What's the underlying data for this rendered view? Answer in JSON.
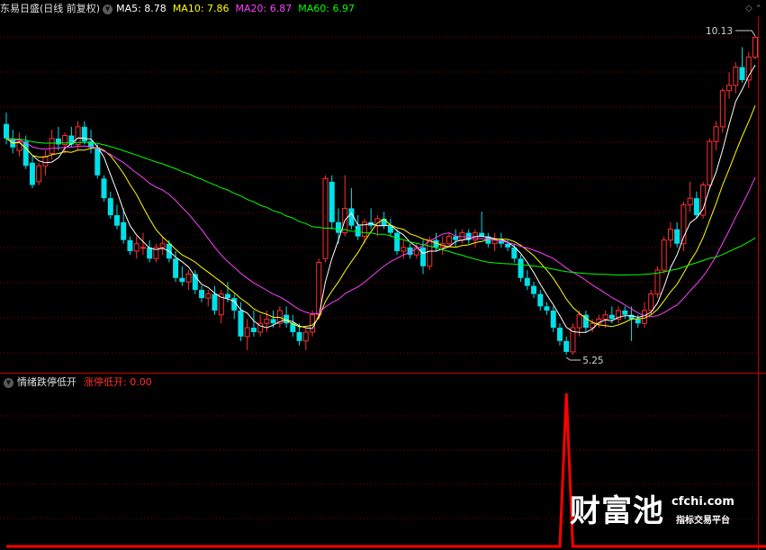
{
  "header": {
    "stock_title": "东易日盛(日线 前复权)",
    "ma_items": [
      {
        "label": "MA5: 8.78",
        "color": "#ffffff"
      },
      {
        "label": "MA10: 7.86",
        "color": "#ffff00"
      },
      {
        "label": "MA20: 6.87",
        "color": "#ff40ff"
      },
      {
        "label": "MA60: 6.97",
        "color": "#00ff00"
      }
    ]
  },
  "indicator_header": {
    "name": "情绪跌停低开",
    "value_label": "涨停低开: 0.00",
    "value_color": "#ff3030"
  },
  "watermark": {
    "brand": "财富池",
    "site": "cfchi.com",
    "tagline": "指标交易平台"
  },
  "colors": {
    "up": "#ff3030",
    "down": "#00e0e8",
    "grid": "#8a0000",
    "background": "#000000"
  },
  "chart_data": [
    {
      "type": "candlestick",
      "title": "东易日盛(日线 前复权)",
      "y_scale": "log",
      "price_annotations": {
        "high": "10.13",
        "low": "5.25"
      },
      "candles": [
        [
          8.45,
          8.65,
          8.1,
          8.2
        ],
        [
          8.2,
          8.35,
          7.95,
          8.05
        ],
        [
          8.0,
          8.3,
          7.9,
          8.15
        ],
        [
          8.15,
          8.25,
          7.7,
          7.75
        ],
        [
          7.8,
          7.9,
          7.4,
          7.45
        ],
        [
          7.5,
          7.8,
          7.45,
          7.75
        ],
        [
          7.75,
          8.0,
          7.6,
          7.9
        ],
        [
          7.95,
          8.35,
          7.85,
          8.2
        ],
        [
          8.2,
          8.4,
          8.0,
          8.1
        ],
        [
          8.1,
          8.3,
          7.95,
          8.25
        ],
        [
          8.25,
          8.4,
          8.05,
          8.1
        ],
        [
          8.1,
          8.5,
          8.0,
          8.4
        ],
        [
          8.4,
          8.5,
          8.1,
          8.15
        ],
        [
          8.15,
          8.35,
          7.95,
          8.05
        ],
        [
          8.05,
          8.1,
          7.55,
          7.6
        ],
        [
          7.55,
          7.6,
          7.2,
          7.25
        ],
        [
          7.25,
          7.35,
          6.95,
          7.0
        ],
        [
          7.0,
          7.15,
          6.8,
          6.85
        ],
        [
          6.9,
          7.1,
          6.6,
          6.65
        ],
        [
          6.65,
          6.7,
          6.45,
          6.5
        ],
        [
          6.5,
          6.7,
          6.4,
          6.6
        ],
        [
          6.55,
          6.75,
          6.45,
          6.55
        ],
        [
          6.55,
          6.65,
          6.35,
          6.4
        ],
        [
          6.4,
          6.6,
          6.35,
          6.55
        ],
        [
          6.55,
          6.7,
          6.45,
          6.6
        ],
        [
          6.6,
          6.65,
          6.35,
          6.4
        ],
        [
          6.4,
          6.5,
          6.1,
          6.15
        ],
        [
          6.15,
          6.3,
          6.05,
          6.1
        ],
        [
          6.1,
          6.25,
          6.0,
          6.2
        ],
        [
          6.2,
          6.25,
          5.95,
          6.0
        ],
        [
          6.0,
          6.05,
          5.85,
          5.9
        ],
        [
          5.9,
          6.0,
          5.8,
          5.95
        ],
        [
          5.95,
          6.05,
          5.7,
          5.75
        ],
        [
          5.7,
          6.0,
          5.6,
          5.95
        ],
        [
          5.95,
          6.1,
          5.85,
          5.9
        ],
        [
          5.9,
          5.95,
          5.65,
          5.75
        ],
        [
          5.75,
          5.85,
          5.4,
          5.45
        ],
        [
          5.45,
          5.65,
          5.3,
          5.55
        ],
        [
          5.55,
          5.75,
          5.45,
          5.5
        ],
        [
          5.5,
          5.7,
          5.45,
          5.6
        ],
        [
          5.6,
          5.75,
          5.5,
          5.65
        ],
        [
          5.65,
          5.75,
          5.55,
          5.6
        ],
        [
          5.6,
          5.8,
          5.55,
          5.75
        ],
        [
          5.7,
          5.8,
          5.55,
          5.6
        ],
        [
          5.6,
          5.7,
          5.45,
          5.5
        ],
        [
          5.5,
          5.6,
          5.35,
          5.4
        ],
        [
          5.4,
          5.55,
          5.3,
          5.5
        ],
        [
          5.5,
          5.75,
          5.45,
          5.7
        ],
        [
          5.7,
          6.4,
          5.65,
          6.35
        ],
        [
          6.4,
          7.6,
          6.35,
          7.55
        ],
        [
          7.5,
          7.6,
          6.8,
          6.9
        ],
        [
          6.9,
          7.1,
          6.6,
          6.75
        ],
        [
          6.75,
          7.6,
          6.7,
          7.1
        ],
        [
          7.1,
          7.4,
          6.8,
          6.85
        ],
        [
          6.85,
          7.0,
          6.65,
          6.7
        ],
        [
          6.7,
          6.95,
          6.6,
          6.9
        ],
        [
          6.9,
          7.1,
          6.8,
          6.85
        ],
        [
          6.85,
          7.0,
          6.7,
          6.95
        ],
        [
          6.95,
          7.05,
          6.8,
          6.85
        ],
        [
          6.85,
          6.95,
          6.7,
          6.75
        ],
        [
          6.75,
          6.8,
          6.45,
          6.5
        ],
        [
          6.5,
          6.65,
          6.4,
          6.55
        ],
        [
          6.55,
          6.6,
          6.4,
          6.45
        ],
        [
          6.45,
          6.6,
          6.4,
          6.55
        ],
        [
          6.55,
          6.65,
          6.2,
          6.3
        ],
        [
          6.3,
          6.7,
          6.25,
          6.65
        ],
        [
          6.65,
          6.75,
          6.5,
          6.55
        ],
        [
          6.55,
          6.7,
          6.45,
          6.6
        ],
        [
          6.6,
          6.75,
          6.55,
          6.7
        ],
        [
          6.7,
          6.8,
          6.55,
          6.65
        ],
        [
          6.65,
          6.8,
          6.6,
          6.75
        ],
        [
          6.75,
          6.8,
          6.6,
          6.65
        ],
        [
          6.65,
          6.8,
          6.55,
          6.75
        ],
        [
          6.75,
          7.05,
          6.7,
          6.7
        ],
        [
          6.7,
          6.75,
          6.55,
          6.6
        ],
        [
          6.6,
          6.75,
          6.5,
          6.65
        ],
        [
          6.65,
          6.75,
          6.55,
          6.6
        ],
        [
          6.6,
          6.65,
          6.5,
          6.55
        ],
        [
          6.55,
          6.6,
          6.35,
          6.4
        ],
        [
          6.4,
          6.45,
          6.1,
          6.15
        ],
        [
          6.15,
          6.25,
          6.0,
          6.05
        ],
        [
          6.05,
          6.1,
          5.9,
          5.95
        ],
        [
          5.95,
          6.0,
          5.75,
          5.8
        ],
        [
          5.8,
          5.85,
          5.7,
          5.75
        ],
        [
          5.75,
          5.8,
          5.5,
          5.55
        ],
        [
          5.55,
          5.6,
          5.35,
          5.4
        ],
        [
          5.4,
          5.45,
          5.25,
          5.28
        ],
        [
          5.28,
          5.6,
          5.25,
          5.55
        ],
        [
          5.55,
          5.75,
          5.45,
          5.7
        ],
        [
          5.7,
          5.75,
          5.5,
          5.55
        ],
        [
          5.55,
          5.65,
          5.5,
          5.6
        ],
        [
          5.6,
          5.7,
          5.55,
          5.65
        ],
        [
          5.65,
          5.75,
          5.55,
          5.7
        ],
        [
          5.7,
          5.8,
          5.6,
          5.65
        ],
        [
          5.65,
          5.8,
          5.6,
          5.75
        ],
        [
          5.75,
          5.8,
          5.65,
          5.7
        ],
        [
          5.7,
          5.8,
          5.4,
          5.65
        ],
        [
          5.65,
          5.7,
          5.55,
          5.6
        ],
        [
          5.6,
          5.85,
          5.55,
          5.75
        ],
        [
          5.75,
          6.0,
          5.7,
          5.95
        ],
        [
          5.95,
          6.3,
          5.9,
          6.25
        ],
        [
          6.25,
          6.7,
          6.2,
          6.65
        ],
        [
          6.65,
          6.9,
          6.55,
          6.8
        ],
        [
          6.8,
          6.9,
          6.55,
          6.6
        ],
        [
          6.6,
          7.2,
          6.5,
          7.15
        ],
        [
          7.15,
          7.5,
          7.05,
          7.25
        ],
        [
          7.25,
          7.35,
          6.95,
          7.0
        ],
        [
          7.0,
          7.5,
          6.95,
          7.45
        ],
        [
          7.45,
          8.2,
          7.4,
          8.15
        ],
        [
          8.15,
          8.5,
          8.0,
          8.4
        ],
        [
          8.4,
          9.1,
          8.3,
          9.05
        ],
        [
          9.05,
          9.4,
          8.9,
          9.15
        ],
        [
          9.15,
          9.6,
          9.0,
          9.5
        ],
        [
          9.5,
          9.9,
          9.2,
          9.25
        ],
        [
          9.25,
          9.8,
          9.1,
          9.7
        ],
        [
          9.7,
          10.13,
          9.65,
          10.1
        ]
      ]
    },
    {
      "type": "line",
      "title": "情绪跌停低开",
      "series": [
        {
          "name": "涨停低开",
          "values": [
            0,
            0,
            0,
            0,
            0,
            0,
            0,
            0,
            0,
            0,
            0,
            0,
            0,
            0,
            0,
            0,
            0,
            0,
            0,
            0,
            0,
            0,
            0,
            0,
            0,
            0,
            0,
            0,
            0,
            0,
            0,
            0,
            0,
            0,
            0,
            0,
            0,
            0,
            0,
            0,
            0,
            0,
            0,
            0,
            0,
            0,
            0,
            0,
            0,
            0,
            0,
            0,
            0,
            0,
            0,
            0,
            0,
            0,
            0,
            0,
            0,
            0,
            0,
            0,
            0,
            0,
            0,
            0,
            0,
            0,
            0,
            0,
            0,
            0,
            0,
            0,
            0,
            0,
            0,
            0,
            0,
            0,
            0,
            0,
            0,
            0,
            1,
            0,
            0,
            0,
            0,
            0,
            0,
            0,
            0,
            0,
            0,
            0,
            0,
            0,
            0,
            0,
            0,
            0,
            0,
            0,
            0,
            0,
            0,
            0,
            0,
            0,
            0,
            0,
            0,
            0,
            0,
            0
          ]
        }
      ]
    }
  ]
}
